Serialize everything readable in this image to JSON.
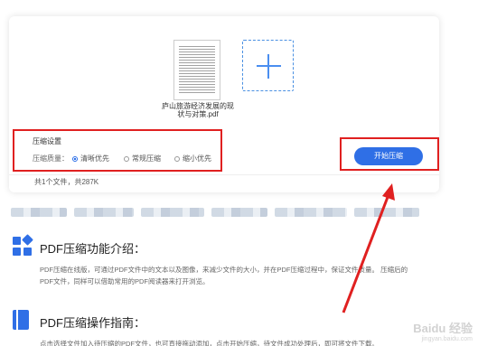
{
  "upload": {
    "file_name": "庐山旅游经济发展的现状与对策.pdf",
    "add_file_icon": "plus-icon"
  },
  "settings": {
    "title": "压缩设置",
    "quality_label": "压缩质量：",
    "options": [
      "清晰优先",
      "常规压缩",
      "缩小优先"
    ],
    "selected": "清晰优先"
  },
  "actions": {
    "start_label": "开始压缩"
  },
  "status": {
    "file_count": "共1个文件，共287K"
  },
  "sections": [
    {
      "icon": "grid-blocks-icon",
      "title": "PDF压缩功能介绍：",
      "text_line1": "PDF压缩在线版，可通过PDF文件中的文本以及图像，来减少文件的大小，并在PDF压缩过程中，保证文件质量。 压缩后的",
      "text_line2": "PDF文件，同样可以借助常用的PDF阅读器来打开浏览。"
    },
    {
      "icon": "book-icon",
      "title": "PDF压缩操作指南：",
      "text_line1": "点击选择文件加入待压缩的PDF文件，也可直接拖动添加，点击开始压缩，待文件成功处理后，即可将文件下载。"
    }
  ],
  "watermark": {
    "brand": "Baidu 经验",
    "url": "jingyan.baidu.com"
  },
  "colors": {
    "accent": "#2f6fe6",
    "highlight": "#e02020"
  }
}
